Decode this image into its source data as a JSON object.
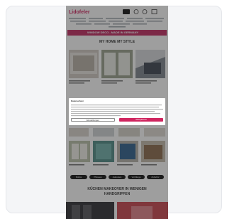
{
  "site": {
    "logo": "Lidofeler",
    "promo_bar": "WINDOW DECO - MADE IN GERMANY",
    "header_icons": [
      "account-icon",
      "heart-icon",
      "cart-icon",
      "menu-icon"
    ]
  },
  "sections": {
    "hero_title": "MY HOME MY STYLE",
    "kitchen_title_line1": "KÜCHEN MAKEOVER IN WENIGEN",
    "kitchen_title_line2": "HANDGRIFFEN"
  },
  "cookie_dialog": {
    "title": "Datenschutz",
    "settings_label": "Einstellungen",
    "accept_label": "Akzeptieren"
  },
  "category_pills": [
    "Rollos",
    "Plissees",
    "Jalousien",
    "Vorhänge",
    "Zubehör"
  ],
  "colors": {
    "brand": "#c12a62",
    "accept": "#d0255f",
    "overlay": "#282828"
  }
}
